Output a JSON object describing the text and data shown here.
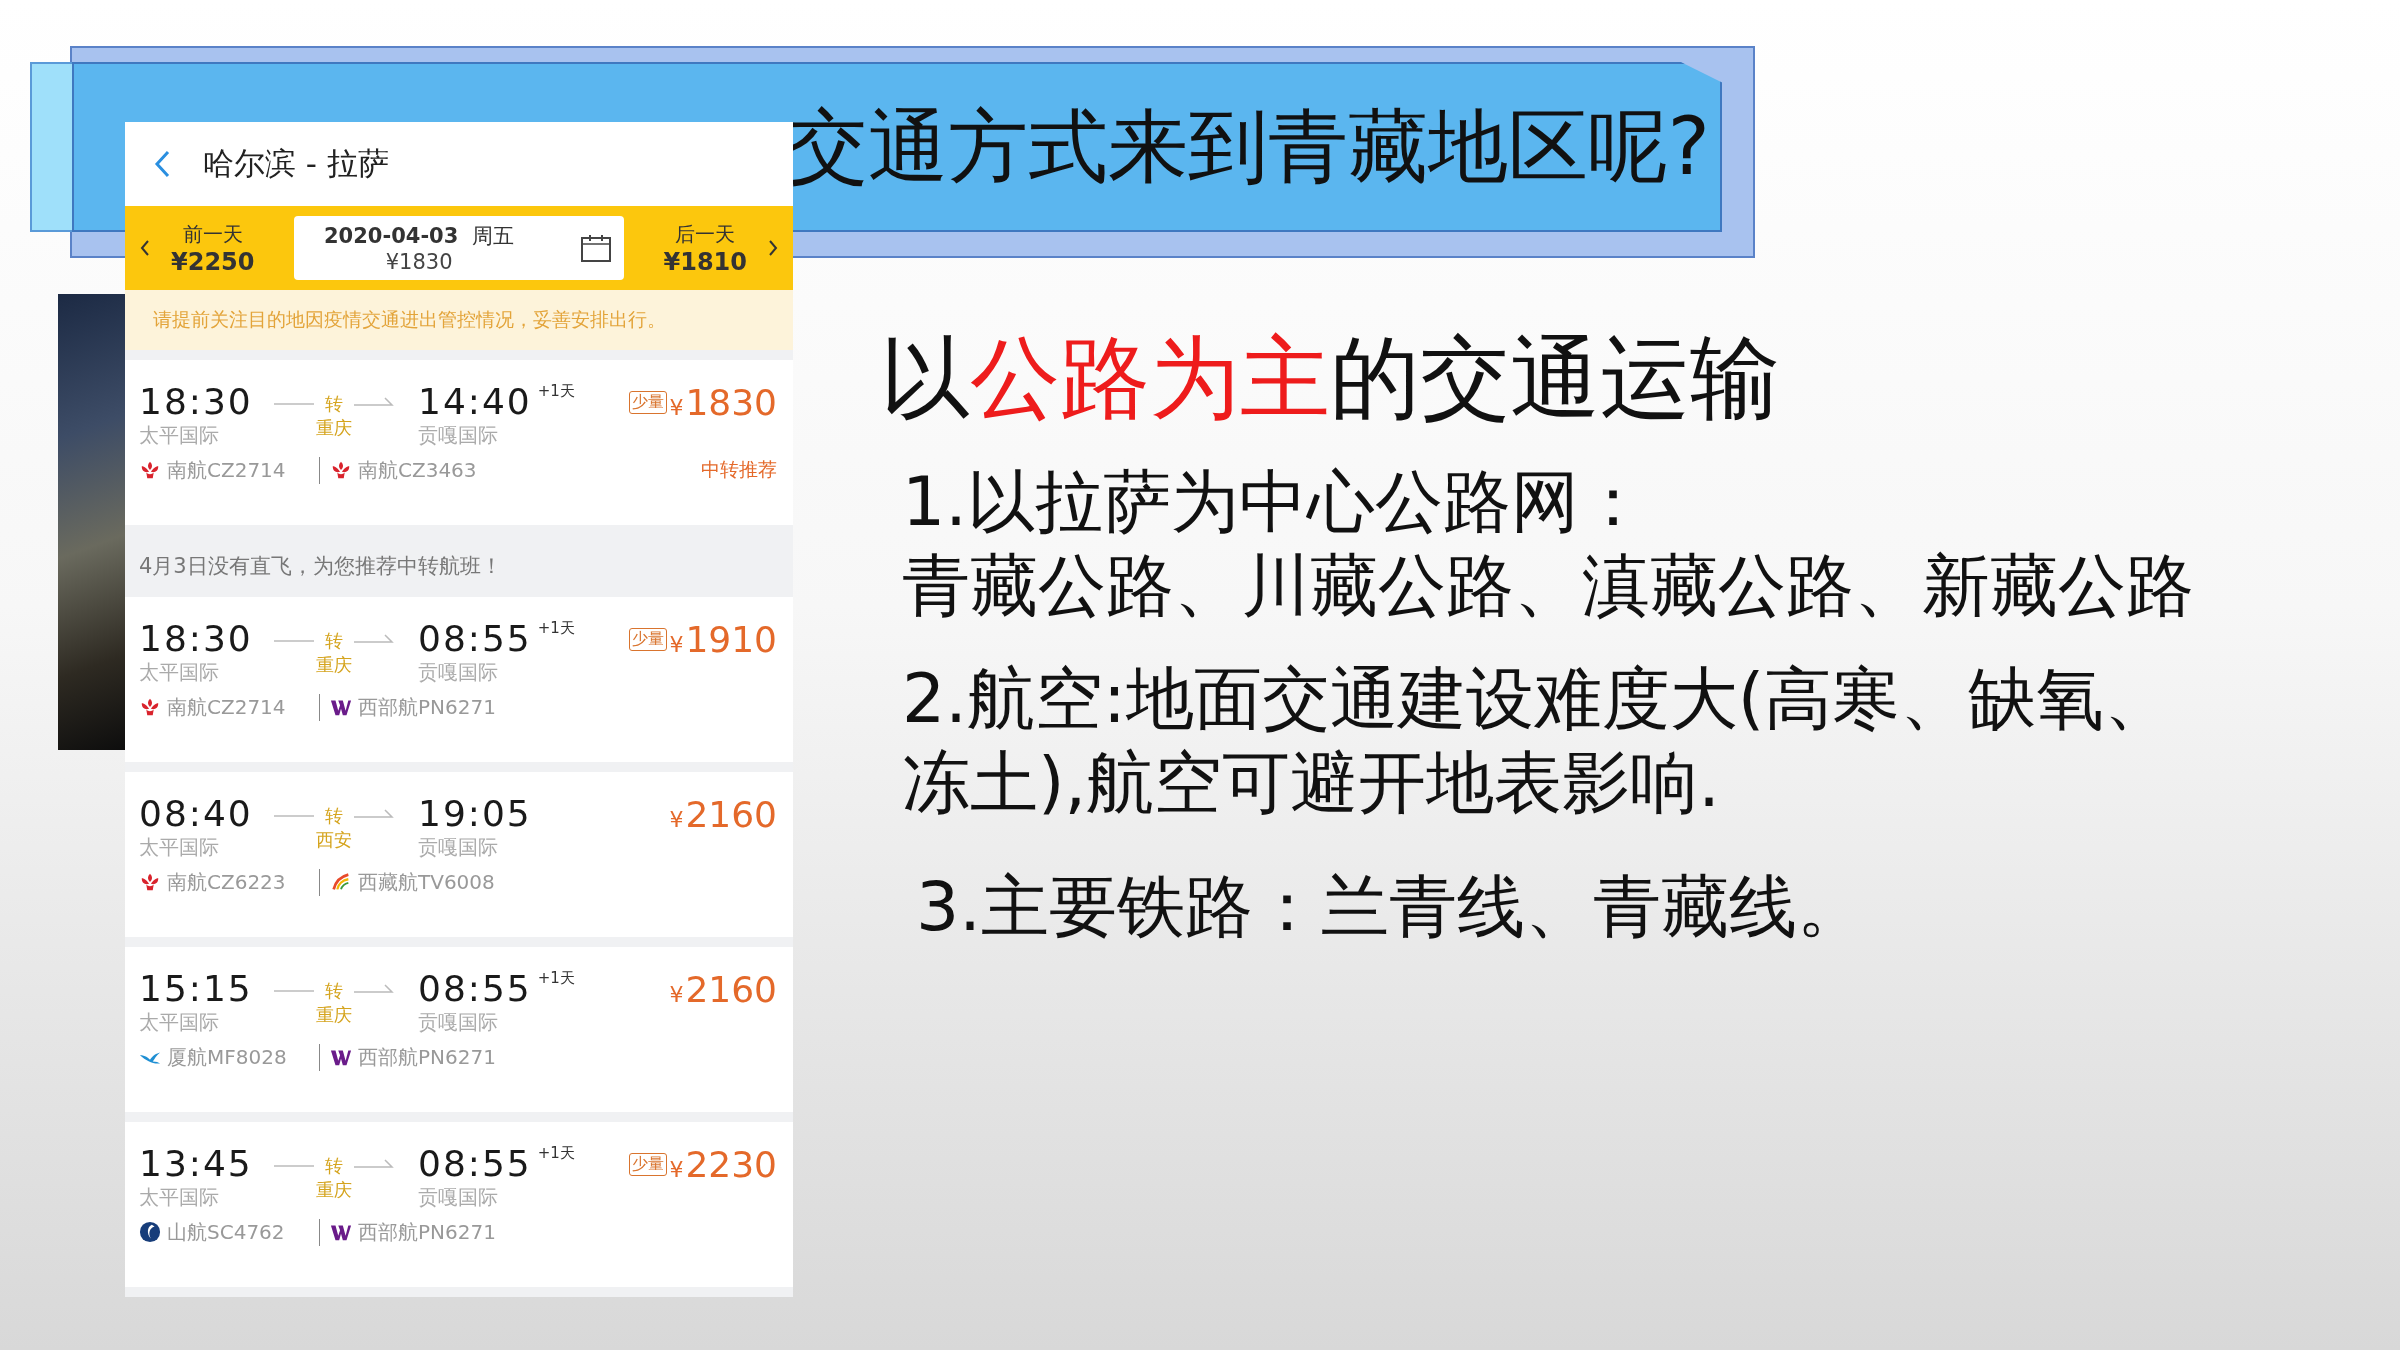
{
  "slide": {
    "title": "交通方式来到青藏地区呢?",
    "heading": [
      {
        "text": "以",
        "emphasis": false
      },
      {
        "text": "公路为主",
        "emphasis": true
      },
      {
        "text": "的交通运输",
        "emphasis": false
      }
    ],
    "points": [
      {
        "text": "1.以拉萨为中心公路网："
      },
      {
        "text": "青藏公路、川藏公路、滇藏公路、新藏公路"
      },
      {
        "text": "2.航空:地面交通建设难度大(高寒、缺氧、冻土),航空可避开地表影响."
      },
      {
        "text": "3.主要铁路：兰青线、青藏线。"
      }
    ]
  },
  "phone": {
    "route": "哈尔滨 - 拉萨",
    "prev_day": {
      "label": "前一天",
      "price": "¥2250"
    },
    "date": "2020-04-03",
    "weekday": "周五",
    "date_price": "¥1830",
    "next_day": {
      "label": "后一天",
      "price": "¥1810"
    },
    "notice": "请提前关注目的地因疫情交通进出管控情况，妥善安排出行。",
    "results": [
      {
        "kind": "flight",
        "dep_time": "18:30",
        "dep_airport": "太平国际",
        "via_label": "转",
        "via_city": "重庆",
        "arr_time": "14:40",
        "next_day": "+1天",
        "arr_airport": "贡嘎国际",
        "badge": "少量",
        "currency": "¥",
        "price": "1830",
        "tag": "中转推荐",
        "segments": [
          {
            "kind": "flower",
            "flight": "南航CZ2714"
          },
          {
            "kind": "flower",
            "flight": "南航CZ3463"
          }
        ]
      },
      {
        "kind": "info",
        "text": "4月3日没有直飞，为您推荐中转航班！"
      },
      {
        "kind": "flight",
        "dep_time": "18:30",
        "dep_airport": "太平国际",
        "via_label": "转",
        "via_city": "重庆",
        "arr_time": "08:55",
        "next_day": "+1天",
        "arr_airport": "贡嘎国际",
        "badge": "少量",
        "currency": "¥",
        "price": "1910",
        "segments": [
          {
            "kind": "flower",
            "flight": "南航CZ2714"
          },
          {
            "kind": "w",
            "flight": "西部航PN6271"
          }
        ]
      },
      {
        "kind": "flight",
        "dep_time": "08:40",
        "dep_airport": "太平国际",
        "via_label": "转",
        "via_city": "西安",
        "arr_time": "19:05",
        "arr_airport": "贡嘎国际",
        "currency": "¥",
        "price": "2160",
        "segments": [
          {
            "kind": "flower",
            "flight": "南航CZ6223"
          },
          {
            "kind": "feather",
            "flight": "西藏航TV6008"
          }
        ]
      },
      {
        "kind": "flight",
        "dep_time": "15:15",
        "dep_airport": "太平国际",
        "via_label": "转",
        "via_city": "重庆",
        "arr_time": "08:55",
        "next_day": "+1天",
        "arr_airport": "贡嘎国际",
        "currency": "¥",
        "price": "2160",
        "segments": [
          {
            "kind": "bird",
            "flight": "厦航MF8028"
          },
          {
            "kind": "w",
            "flight": "西部航PN6271"
          }
        ]
      },
      {
        "kind": "flight",
        "dep_time": "13:45",
        "dep_airport": "太平国际",
        "via_label": "转",
        "via_city": "重庆",
        "arr_time": "08:55",
        "next_day": "+1天",
        "arr_airport": "贡嘎国际",
        "badge": "少量",
        "currency": "¥",
        "price": "2230",
        "segments": [
          {
            "kind": "crescent",
            "flight": "山航SC4762"
          },
          {
            "kind": "w",
            "flight": "西部航PN6271"
          }
        ]
      }
    ]
  }
}
